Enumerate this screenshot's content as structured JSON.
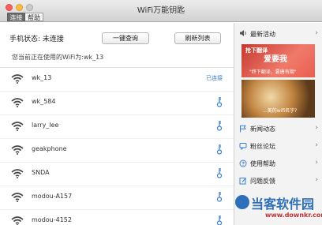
{
  "window": {
    "title": "WiFi万能钥匙",
    "tabs": [
      {
        "label": "连接"
      },
      {
        "label": "帮助"
      }
    ]
  },
  "status": {
    "label": "手机状态: 未连接",
    "query_button": "一键查询",
    "refresh_button": "刷新列表",
    "current_text": "您当前正在使用的WiFi为:wk_13"
  },
  "networks": [
    {
      "name": "wk_13",
      "status": "已连接",
      "has_key": false
    },
    {
      "name": "wk_584",
      "status": "",
      "has_key": true
    },
    {
      "name": "larry_lee",
      "status": "",
      "has_key": true
    },
    {
      "name": "geakphone",
      "status": "",
      "has_key": true
    },
    {
      "name": "SNDA",
      "status": "",
      "has_key": true
    },
    {
      "name": "modou-A157",
      "status": "",
      "has_key": true
    },
    {
      "name": "modou-4152",
      "status": "",
      "has_key": true
    }
  ],
  "sidebar": {
    "header": "最新活动",
    "banner1": {
      "line1": "抢下翻译",
      "line2": "爱要我",
      "line3": "\"终下翻译，要唐有期\""
    },
    "banner2": {
      "line1": "...美的wifi名字?"
    },
    "items": [
      {
        "label": "新闻动态",
        "icon": "flag-icon"
      },
      {
        "label": "粉丝论坛",
        "icon": "chat-icon"
      },
      {
        "label": "使用帮助",
        "icon": "help-icon"
      },
      {
        "label": "问题反馈",
        "icon": "edit-icon"
      }
    ]
  },
  "watermark": {
    "line1": "当客软件园",
    "line2": "www.downkr.com"
  },
  "colors": {
    "link": "#3a7fd6",
    "accent_red": "#c23030",
    "accent_blue": "#2f6fb9"
  }
}
